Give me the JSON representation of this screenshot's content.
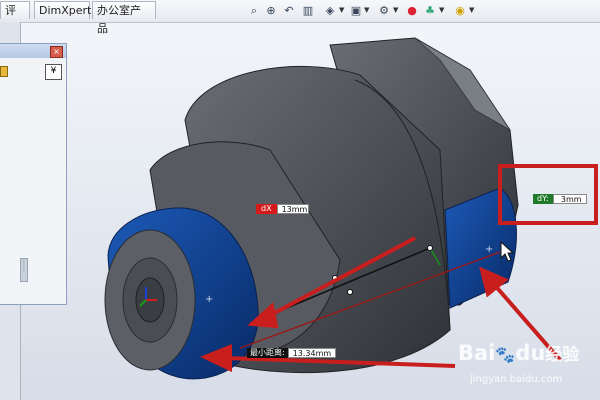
{
  "menu_tabs": [
    "评估",
    "DimXpert",
    "办公室产品"
  ],
  "sidebar": {
    "chevron": "»"
  },
  "panel": {
    "close_glyph": "×",
    "expand_glyph": "¥"
  },
  "toolbar_icons": [
    "zoom-to-fit-icon",
    "zoom-area-icon",
    "previous-view-icon",
    "section-view-icon",
    "view-orientation-icon",
    "display-style-icon",
    "hide-show-icon",
    "edit-appearance-icon",
    "apply-scene-icon",
    "view-settings-icon"
  ],
  "measurements": {
    "dx": {
      "label": "dX",
      "value": "13mm"
    },
    "dy": {
      "label": "dY:",
      "value": "3mm"
    },
    "min_dist": {
      "label": "最小距离:",
      "value": "13.34mm"
    }
  },
  "colors": {
    "selection_blue": "#0b3c8c",
    "part_gray": "#55595f",
    "highlight_red": "#c81e1e"
  },
  "watermark": {
    "brand": "Bai",
    "brand2": "du",
    "paw": "🐾",
    "jingyan": "经验",
    "url": "jingyan.baidu.com"
  }
}
